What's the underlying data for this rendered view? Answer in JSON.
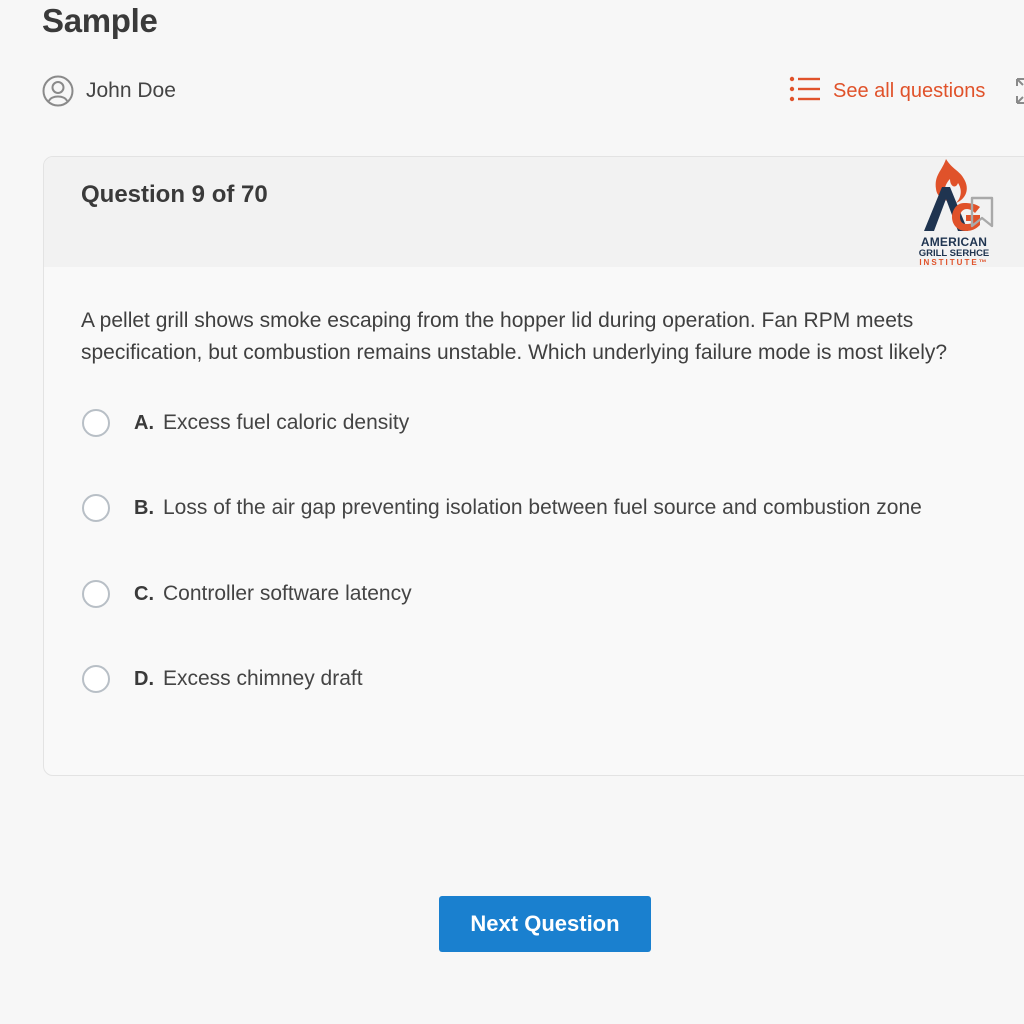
{
  "app": {
    "title": "Sample"
  },
  "user": {
    "name": "John Doe",
    "icon": "user-circle-icon"
  },
  "header": {
    "see_all_label": "See all questions",
    "see_all_icon": "list-icon",
    "expand_icon": "expand-icon"
  },
  "question": {
    "counter": "Question 9 of 70",
    "text": "A pellet grill shows smoke escaping from the hopper lid during operation. Fan RPM meets specification, but combustion remains unstable. Which underlying failure mode is most likely?",
    "bookmark_icon": "bookmark-icon",
    "options": [
      {
        "letter": "A.",
        "text": "Excess fuel caloric density",
        "selected": false
      },
      {
        "letter": "B.",
        "text": "Loss of the air gap preventing isolation between fuel source and combustion zone",
        "selected": false
      },
      {
        "letter": "C.",
        "text": "Controller software latency",
        "selected": false
      },
      {
        "letter": "D.",
        "text": "Excess chimney draft",
        "selected": false
      }
    ]
  },
  "logo": {
    "line1": "AMERICAN",
    "line2": "GRILL SERHCE",
    "line3": "INSTITUTE™"
  },
  "footer": {
    "next_label": "Next Question"
  },
  "colors": {
    "accent": "#e0522a",
    "primary_button": "#1a80cf",
    "logo_navy": "#1f3450",
    "background": "#f7f7f7"
  }
}
